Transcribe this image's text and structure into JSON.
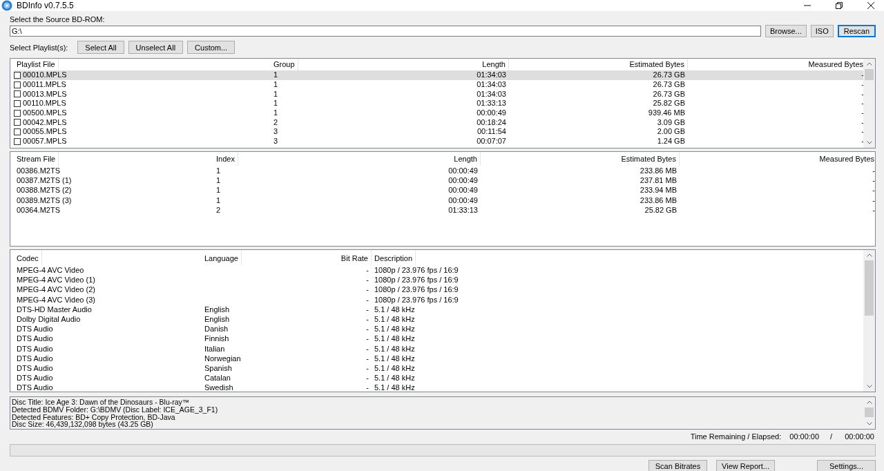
{
  "window": {
    "title": "BDInfo v0.7.5.5"
  },
  "source": {
    "label": "Select the Source BD-ROM:",
    "value": "G:\\",
    "buttons": [
      "Browse...",
      "ISO",
      "Rescan"
    ]
  },
  "playlist_select": {
    "label": "Select Playlist(s):",
    "buttons": [
      "Select All",
      "Unselect All",
      "Custom..."
    ]
  },
  "playlists": {
    "columns": [
      "Playlist File",
      "Group",
      "Length",
      "Estimated Bytes",
      "Measured Bytes"
    ],
    "rows": [
      {
        "cells": [
          "00010.MPLS",
          "1",
          "01:34:03",
          "26.73 GB",
          "-"
        ],
        "checked": false,
        "selected": true
      },
      {
        "cells": [
          "00011.MPLS",
          "1",
          "01:34:03",
          "26.73 GB",
          "-"
        ],
        "checked": false,
        "selected": false
      },
      {
        "cells": [
          "00013.MPLS",
          "1",
          "01:34:03",
          "26.73 GB",
          "-"
        ],
        "checked": false,
        "selected": false
      },
      {
        "cells": [
          "00110.MPLS",
          "1",
          "01:33:13",
          "25.82 GB",
          "-"
        ],
        "checked": false,
        "selected": false
      },
      {
        "cells": [
          "00500.MPLS",
          "1",
          "00:00:49",
          "939.46 MB",
          "-"
        ],
        "checked": false,
        "selected": false
      },
      {
        "cells": [
          "00042.MPLS",
          "2",
          "00:18:24",
          "3.09 GB",
          "-"
        ],
        "checked": false,
        "selected": false
      },
      {
        "cells": [
          "00055.MPLS",
          "3",
          "00:11:54",
          "2.00 GB",
          "-"
        ],
        "checked": false,
        "selected": false
      },
      {
        "cells": [
          "00057.MPLS",
          "3",
          "00:07:07",
          "1.24 GB",
          "-"
        ],
        "checked": false,
        "selected": false
      }
    ]
  },
  "streams": {
    "columns": [
      "Stream File",
      "Index",
      "Length",
      "Estimated Bytes",
      "Measured Bytes"
    ],
    "rows": [
      [
        "00386.M2TS",
        "1",
        "00:00:49",
        "233.86 MB",
        "-"
      ],
      [
        "00387.M2TS (1)",
        "1",
        "00:00:49",
        "237.81 MB",
        "-"
      ],
      [
        "00388.M2TS (2)",
        "1",
        "00:00:49",
        "233.94 MB",
        "-"
      ],
      [
        "00389.M2TS (3)",
        "1",
        "00:00:49",
        "233.86 MB",
        "-"
      ],
      [
        "00364.M2TS",
        "2",
        "01:33:13",
        "25.82 GB",
        "-"
      ]
    ]
  },
  "codecs": {
    "columns": [
      "Codec",
      "Language",
      "Bit Rate",
      "Description"
    ],
    "rows": [
      [
        "MPEG-4 AVC Video",
        "",
        "-",
        "1080p / 23.976 fps / 16:9"
      ],
      [
        "MPEG-4 AVC Video (1)",
        "",
        "-",
        "1080p / 23.976 fps / 16:9"
      ],
      [
        "MPEG-4 AVC Video (2)",
        "",
        "-",
        "1080p / 23.976 fps / 16:9"
      ],
      [
        "MPEG-4 AVC Video (3)",
        "",
        "-",
        "1080p / 23.976 fps / 16:9"
      ],
      [
        "DTS-HD Master Audio",
        "English",
        "-",
        "5.1 / 48 kHz"
      ],
      [
        "Dolby Digital Audio",
        "English",
        "-",
        "5.1 / 48 kHz"
      ],
      [
        "DTS Audio",
        "Danish",
        "-",
        "5.1 / 48 kHz"
      ],
      [
        "DTS Audio",
        "Finnish",
        "-",
        "5.1 / 48 kHz"
      ],
      [
        "DTS Audio",
        "Italian",
        "-",
        "5.1 / 48 kHz"
      ],
      [
        "DTS Audio",
        "Norwegian",
        "-",
        "5.1 / 48 kHz"
      ],
      [
        "DTS Audio",
        "Spanish",
        "-",
        "5.1 / 48 kHz"
      ],
      [
        "DTS Audio",
        "Catalan",
        "-",
        "5.1 / 48 kHz"
      ],
      [
        "DTS Audio",
        "Swedish",
        "-",
        "5.1 / 48 kHz"
      ]
    ]
  },
  "disc_info": [
    "Disc Title: Ice Age 3: Dawn of the Dinosaurs - Blu-ray™",
    "Detected BDMV Folder: G:\\BDMV (Disc Label: ICE_AGE_3_F1)",
    "Detected Features: BD+ Copy Protection, BD-Java",
    "Disc Size: 46,439,132,098 bytes (43.25 GB)"
  ],
  "time": {
    "label": "Time Remaining / Elapsed:",
    "remaining": "00:00:00",
    "separator": "/",
    "elapsed": "00:00:00"
  },
  "progress": {
    "level": 0
  },
  "bottom_buttons": [
    "Scan Bitrates",
    "View Report...",
    "Settings..."
  ]
}
